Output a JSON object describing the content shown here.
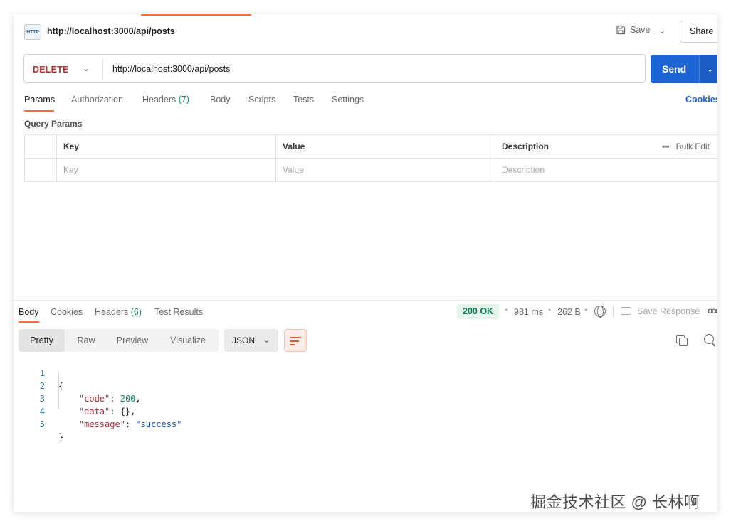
{
  "request": {
    "title": "http://localhost:3000/api/posts",
    "icon_label": "HTTP",
    "save_label": "Save",
    "share_label": "Share",
    "method": "DELETE",
    "url": "http://localhost:3000/api/posts",
    "send_label": "Send"
  },
  "request_tabs": {
    "params": "Params",
    "authorization": "Authorization",
    "headers": "Headers",
    "headers_count": "(7)",
    "body": "Body",
    "scripts": "Scripts",
    "tests": "Tests",
    "settings": "Settings",
    "cookies": "Cookies"
  },
  "query_params": {
    "title": "Query Params",
    "columns": [
      "Key",
      "Value",
      "Description"
    ],
    "placeholders": [
      "Key",
      "Value",
      "Description"
    ],
    "bulk_edit": "Bulk Edit"
  },
  "response": {
    "tabs": {
      "body": "Body",
      "cookies": "Cookies",
      "headers": "Headers",
      "headers_count": "(6)",
      "test_results": "Test Results"
    },
    "status": "200 OK",
    "time": "981 ms",
    "size": "262 B",
    "save_response": "Save Response",
    "views": [
      "Pretty",
      "Raw",
      "Preview",
      "Visualize"
    ],
    "format": "JSON",
    "line_numbers": [
      "1",
      "2",
      "3",
      "4",
      "5"
    ],
    "json": {
      "open": "{",
      "close": "}",
      "code_key": "\"code\"",
      "code_value": "200",
      "data_key": "\"data\"",
      "data_value": "{}",
      "message_key": "\"message\"",
      "message_value": "\"success\""
    }
  },
  "watermark": "掘金技术社区 @ 长林啊",
  "colors": {
    "accent": "#ff6c37",
    "send": "#1c64d4",
    "method_delete": "#b43434",
    "status_ok": "#0c7a4e"
  }
}
